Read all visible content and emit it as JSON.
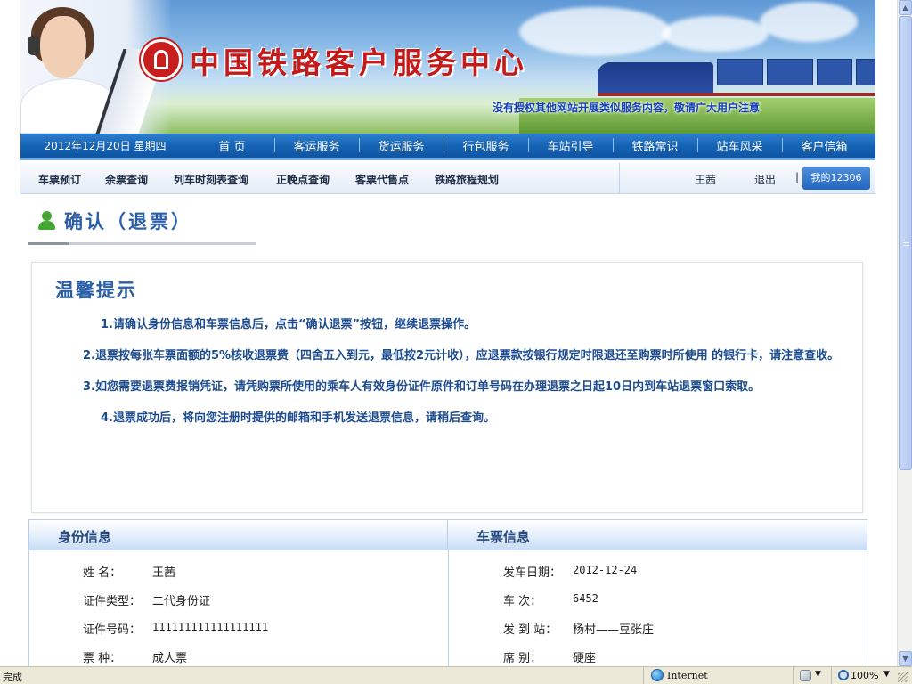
{
  "banner": {
    "site_title": "中国铁路客户服务中心",
    "notice": "没有授权其他网站开展类似服务内容，敬请广大用户注意"
  },
  "main_nav": {
    "date": "2012年12月20日  星期四",
    "items": [
      "首  页",
      "客运服务",
      "货运服务",
      "行包服务",
      "车站引导",
      "铁路常识",
      "站车风采",
      "客户信箱"
    ]
  },
  "sub_nav": {
    "items": [
      "车票预订",
      "余票查询",
      "列车时刻表查询",
      "正晚点查询",
      "客票代售点",
      "铁路旅程规划"
    ],
    "user_name": "王茜",
    "logout": "退出",
    "separator": "|",
    "my12306": "我的12306"
  },
  "page": {
    "title": "确认（退票）"
  },
  "tips": {
    "title": "温馨提示",
    "items": [
      "1.请确认身份信息和车票信息后，点击“确认退票”按钮，继续退票操作。",
      "2.退票按每张车票面额的5%核收退票费（四舍五入到元，最低按2元计收），应退票款按银行规定时限退还至购票时所使用 的银行卡，请注意查收。",
      "3.如您需要退票费报销凭证，请凭购票所使用的乘车人有效身份证件原件和订单号码在办理退票之日起10日内到车站退票窗口索取。",
      "4.退票成功后，将向您注册时提供的邮箱和手机发送退票信息，请稍后查询。"
    ]
  },
  "identity": {
    "title": "身份信息",
    "fields": [
      {
        "label": "姓     名：",
        "value": "王茜"
      },
      {
        "label": "证件类型：",
        "value": "二代身份证"
      },
      {
        "label": "证件号码：",
        "value": "111111111111111111"
      },
      {
        "label": "票     种：",
        "value": "成人票"
      }
    ]
  },
  "ticket": {
    "title": "车票信息",
    "fields": [
      {
        "label": "发车日期：",
        "value": "2012-12-24"
      },
      {
        "label": "车     次：",
        "value": "6452"
      },
      {
        "label": "发  到  站：",
        "value": "杨村——豆张庄"
      },
      {
        "label": "席     别：",
        "value": "硬座"
      }
    ]
  },
  "status_bar": {
    "status": "完成",
    "zone": "Internet",
    "zoom": "100%"
  }
}
